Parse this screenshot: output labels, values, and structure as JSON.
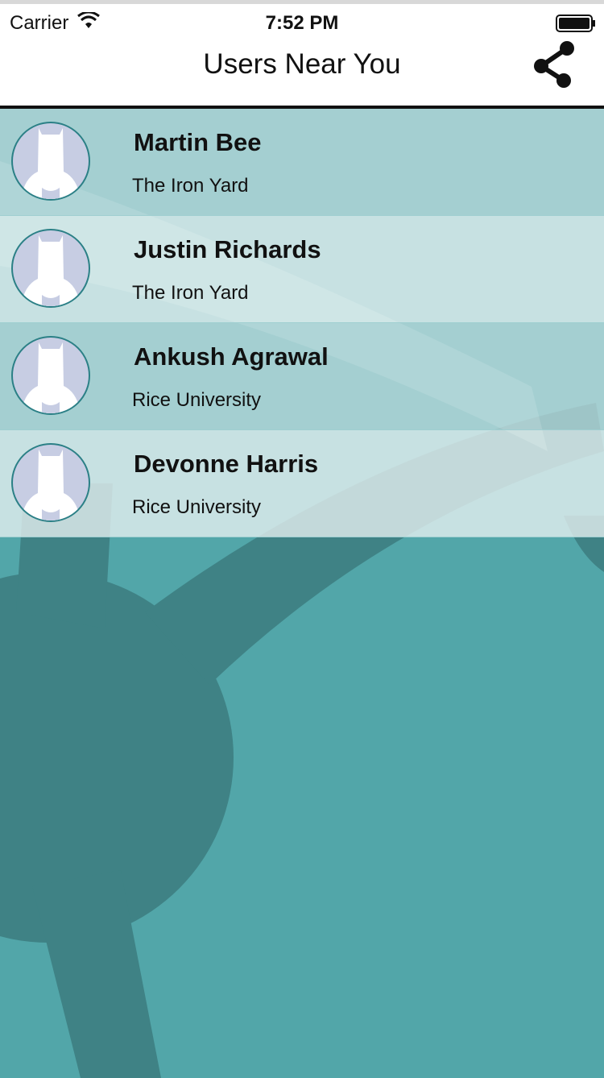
{
  "status_bar": {
    "carrier": "Carrier",
    "time": "7:52 PM",
    "icons": [
      "wifi-icon",
      "battery-icon"
    ]
  },
  "nav_bar": {
    "title": "Users Near You",
    "action_icon": "share-icon"
  },
  "users": [
    {
      "name": "Martin Bee",
      "company": "The Iron Yard"
    },
    {
      "name": "Justin Richards",
      "company": "The Iron Yard"
    },
    {
      "name": "Ankush Agrawal",
      "company": "Rice University"
    },
    {
      "name": "Devonne Harris",
      "company": "Rice University"
    }
  ],
  "colors": {
    "background": "#52a6a9",
    "background_shape": "#3f8285",
    "row_dark": "#b9dcdd",
    "row_light": "#dcebeb",
    "avatar_ring": "#2b8086",
    "avatar_fill": "#c7cde3"
  }
}
